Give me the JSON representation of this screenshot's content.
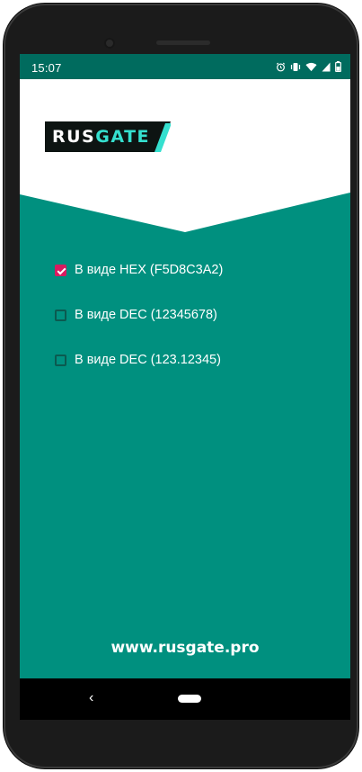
{
  "status_bar": {
    "time": "15:07",
    "icons": [
      "alarm-icon",
      "vibrate-icon",
      "wifi-icon",
      "signal-icon",
      "battery-icon"
    ]
  },
  "brand": {
    "logo_part1": "RUS",
    "logo_part2": "GATE",
    "accent_color": "#35e0cf",
    "background_color": "#00907f"
  },
  "options": [
    {
      "label": "В виде HEX (F5D8C3A2)",
      "checked": true
    },
    {
      "label": "В виде DEC (12345678)",
      "checked": false
    },
    {
      "label": "В виде DEC (123.12345)",
      "checked": false
    }
  ],
  "footer": {
    "website": "www.rusgate.pro"
  },
  "nav": {
    "back_glyph": "‹"
  }
}
